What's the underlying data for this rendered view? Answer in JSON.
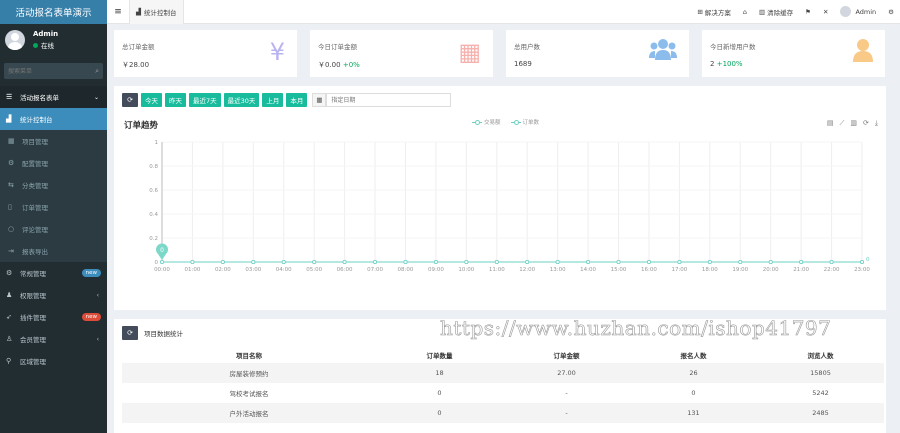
{
  "app": {
    "title": "活动报名表单演示"
  },
  "user": {
    "name": "Admin",
    "status": "在线"
  },
  "search": {
    "placeholder": "搜索菜单",
    "icon": "search-icon"
  },
  "menu": {
    "group1": {
      "label": "活动报名表单",
      "icon": "list-icon"
    },
    "items": [
      {
        "label": "统计控制台",
        "icon": "chart-icon",
        "active": true
      },
      {
        "label": "项目管理",
        "icon": "grid-icon"
      },
      {
        "label": "配置管理",
        "icon": "gear-icon"
      },
      {
        "label": "分类管理",
        "icon": "share-icon"
      },
      {
        "label": "订单管理",
        "icon": "document-icon"
      },
      {
        "label": "评论管理",
        "icon": "comment-icon"
      },
      {
        "label": "报表导出",
        "icon": "export-icon"
      }
    ],
    "groups": [
      {
        "label": "常规管理",
        "icon": "gears-icon",
        "badge": "new",
        "badge_color": "#3c8dbc"
      },
      {
        "label": "权限管理",
        "icon": "users-icon",
        "chevron": "‹"
      },
      {
        "label": "插件管理",
        "icon": "rocket-icon",
        "badge": "new",
        "badge_color": "#dd4b39"
      },
      {
        "label": "会员管理",
        "icon": "user-icon",
        "chevron": "‹"
      },
      {
        "label": "区域管理",
        "icon": "map-marker-icon"
      }
    ]
  },
  "header": {
    "tab": "统计控制台",
    "solutions": "解决方案",
    "clear_cache": "清除缓存",
    "admin": "Admin"
  },
  "stats": [
    {
      "label": "总订单金额",
      "value": "￥28.00",
      "extra": "",
      "icon": "yen-icon",
      "color": "#b8b3f0",
      "glyph": "¥"
    },
    {
      "label": "今日订单金额",
      "value": "￥0.00",
      "extra": "+0%",
      "icon": "calendar-icon",
      "color": "#f6b1ad",
      "glyph": "▦"
    },
    {
      "label": "总用户数",
      "value": "1689",
      "extra": "",
      "icon": "users-icon",
      "color": "#8cbcec",
      "glyph": "👥"
    },
    {
      "label": "今日新增用户数",
      "value": "2",
      "extra": "+100%",
      "icon": "user-icon",
      "color": "#f8c987",
      "glyph": "●"
    }
  ],
  "filters": {
    "buttons": [
      "今天",
      "昨天",
      "最近7天",
      "最近30天",
      "上月",
      "本月"
    ],
    "date_placeholder": "指定日期"
  },
  "chart": {
    "title": "订单趋势",
    "legend": [
      "交易额",
      "订单数"
    ],
    "toolbox": [
      "data-view-icon",
      "line-icon",
      "bar-icon",
      "restore-icon",
      "download-icon"
    ]
  },
  "chart_data": {
    "type": "line",
    "title": "订单趋势",
    "x": [
      "00:00",
      "01:00",
      "02:00",
      "03:00",
      "04:00",
      "05:00",
      "06:00",
      "07:00",
      "08:00",
      "09:00",
      "10:00",
      "11:00",
      "12:00",
      "13:00",
      "14:00",
      "15:00",
      "16:00",
      "17:00",
      "18:00",
      "19:00",
      "20:00",
      "21:00",
      "22:00",
      "23:00"
    ],
    "yticks": [
      "0",
      "0.2",
      "0.4",
      "0.6",
      "0.8",
      "1"
    ],
    "ylim": [
      0,
      1
    ],
    "series": [
      {
        "name": "交易额",
        "values": [
          0,
          0,
          0,
          0,
          0,
          0,
          0,
          0,
          0,
          0,
          0,
          0,
          0,
          0,
          0,
          0,
          0,
          0,
          0,
          0,
          0,
          0,
          0,
          0
        ]
      },
      {
        "name": "订单数",
        "values": [
          0,
          0,
          0,
          0,
          0,
          0,
          0,
          0,
          0,
          0,
          0,
          0,
          0,
          0,
          0,
          0,
          0,
          0,
          0,
          0,
          0,
          0,
          0,
          0
        ]
      }
    ],
    "callout": {
      "text": "0",
      "x": "00:00"
    },
    "end_label": "0",
    "color": "#6ed1c4",
    "grid": true
  },
  "table": {
    "title": "项目数据统计",
    "headers": [
      "项目名称",
      "订单数量",
      "订单金额",
      "报名人数",
      "浏览人数"
    ],
    "rows": [
      [
        "房屋装修预约",
        "18",
        "27.00",
        "26",
        "15805"
      ],
      [
        "驾校考试报名",
        "0",
        "-",
        "0",
        "5242"
      ],
      [
        "户外活动报名",
        "0",
        "-",
        "131",
        "2485"
      ]
    ]
  },
  "watermark": "https://www.huzhan.com/ishop41797"
}
